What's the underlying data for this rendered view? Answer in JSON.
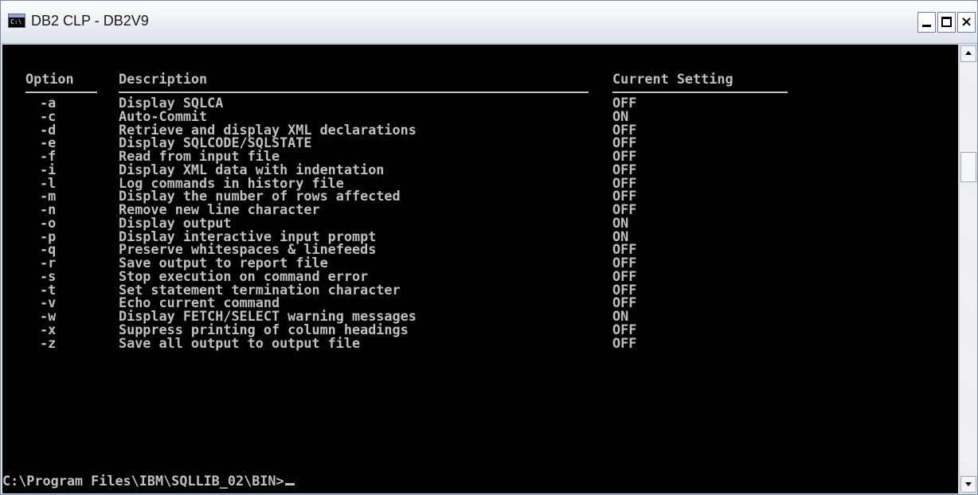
{
  "window": {
    "title": "DB2 CLP - DB2V9",
    "icon": "console-icon",
    "icon_text": "C:\\"
  },
  "table": {
    "headers": {
      "option": "Option",
      "description": "Description",
      "setting": "Current Setting"
    },
    "rows": [
      {
        "option": "-a",
        "description": "Display SQLCA",
        "setting": "OFF"
      },
      {
        "option": "-c",
        "description": "Auto-Commit",
        "setting": "ON"
      },
      {
        "option": "-d",
        "description": "Retrieve and display XML declarations",
        "setting": "OFF"
      },
      {
        "option": "-e",
        "description": "Display SQLCODE/SQLSTATE",
        "setting": "OFF"
      },
      {
        "option": "-f",
        "description": "Read from input file",
        "setting": "OFF"
      },
      {
        "option": "-i",
        "description": "Display XML data with indentation",
        "setting": "OFF"
      },
      {
        "option": "-l",
        "description": "Log commands in history file",
        "setting": "OFF"
      },
      {
        "option": "-m",
        "description": "Display the number of rows affected",
        "setting": "OFF"
      },
      {
        "option": "-n",
        "description": "Remove new line character",
        "setting": "OFF"
      },
      {
        "option": "-o",
        "description": "Display output",
        "setting": "ON"
      },
      {
        "option": "-p",
        "description": "Display interactive input prompt",
        "setting": "ON"
      },
      {
        "option": "-q",
        "description": "Preserve whitespaces & linefeeds",
        "setting": "OFF"
      },
      {
        "option": "-r",
        "description": "Save output to report file",
        "setting": "OFF"
      },
      {
        "option": "-s",
        "description": "Stop execution on command error",
        "setting": "OFF"
      },
      {
        "option": "-t",
        "description": "Set statement termination character",
        "setting": "OFF"
      },
      {
        "option": "-v",
        "description": "Echo current command",
        "setting": "OFF"
      },
      {
        "option": "-w",
        "description": "Display FETCH/SELECT warning messages",
        "setting": "ON"
      },
      {
        "option": "-x",
        "description": "Suppress printing of column headings",
        "setting": "OFF"
      },
      {
        "option": "-z",
        "description": "Save all output to output file",
        "setting": "OFF"
      }
    ]
  },
  "prompt": "C:\\Program Files\\IBM\\SQLLIB_02\\BIN>",
  "colors": {
    "console_bg": "#000000",
    "console_text": "#c0c0c0"
  }
}
